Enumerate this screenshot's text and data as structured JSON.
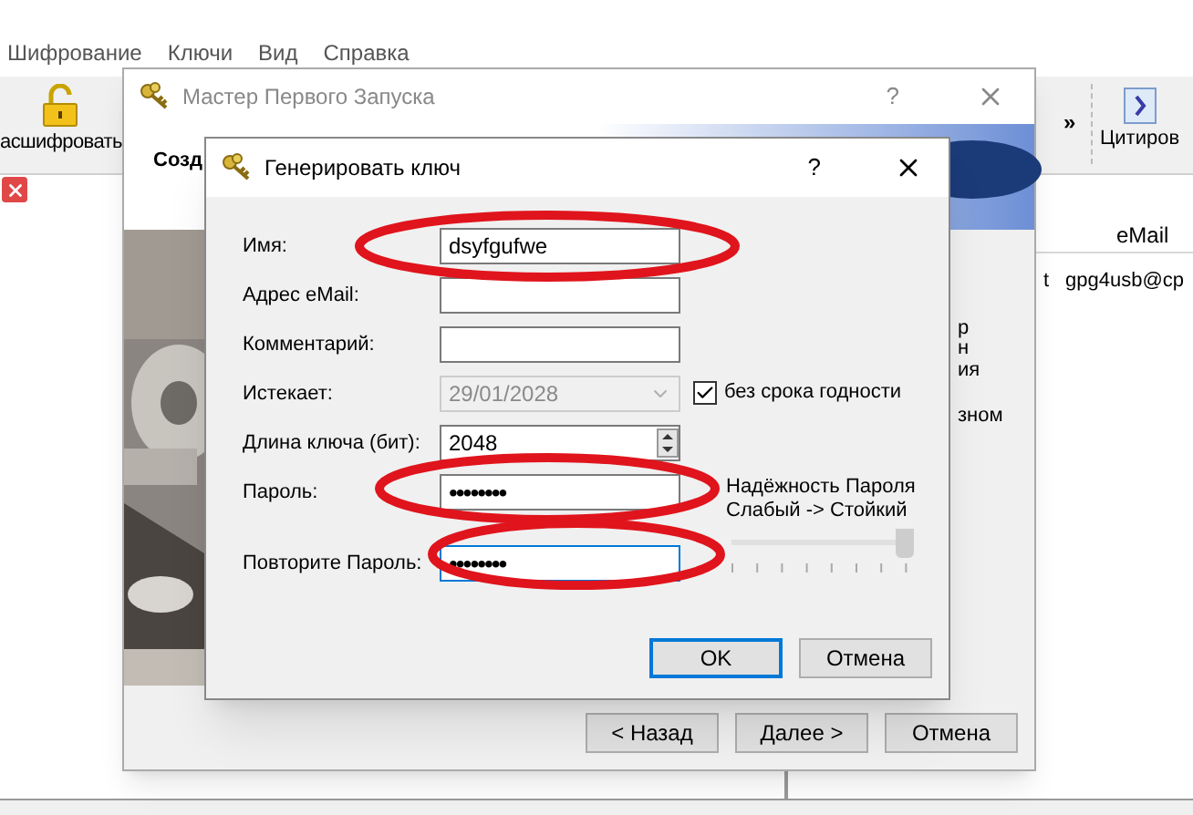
{
  "menu": [
    "Шифрование",
    "Ключи",
    "Вид",
    "Справка"
  ],
  "toolbar": {
    "left_button": "асшифровать",
    "overflow": "»",
    "right_button": "Цитиров"
  },
  "table": {
    "email_header": "eMail",
    "rows": [
      {
        "column_1": "t",
        "email": "gpg4usb@cp"
      }
    ]
  },
  "wizard": {
    "title": "Мастер Первого Запуска",
    "help": "?",
    "heading": "Созд",
    "side_text": [
      "р",
      "н",
      "ия",
      "зном"
    ],
    "buttons": [
      "< Назад",
      "Далее >",
      "Отмена"
    ]
  },
  "dialog": {
    "title": "Генерировать ключ",
    "help": "?",
    "fields": [
      {
        "kind": "text",
        "label": "Имя:",
        "value": "dsyfgufwe",
        "focused": false
      },
      {
        "kind": "text",
        "label": "Адрес eMail:",
        "focused": false
      },
      {
        "kind": "text",
        "label": "Комментарий:",
        "focused": false
      },
      {
        "kind": "date",
        "label": "Истекает:",
        "value": "29/01/2028",
        "disabled": true
      },
      {
        "kind": "spin",
        "label": "Длина ключа (бит):",
        "value": "2048"
      },
      {
        "kind": "text",
        "label": "Пароль:",
        "value": "••••••••",
        "focused": false
      },
      {
        "kind": "text",
        "label": "Повторите Пароль:",
        "value": "••••••••",
        "focused": true
      }
    ],
    "no_expiry": {
      "label": "без срока годности",
      "checked": true
    },
    "strength": {
      "title": "Надёжность Пароля",
      "scale": "Слабый -> Стойкий",
      "level": 0.95
    },
    "buttons": [
      {
        "label": "OK",
        "default": true
      },
      {
        "label": "Отмена",
        "default": false
      }
    ]
  }
}
